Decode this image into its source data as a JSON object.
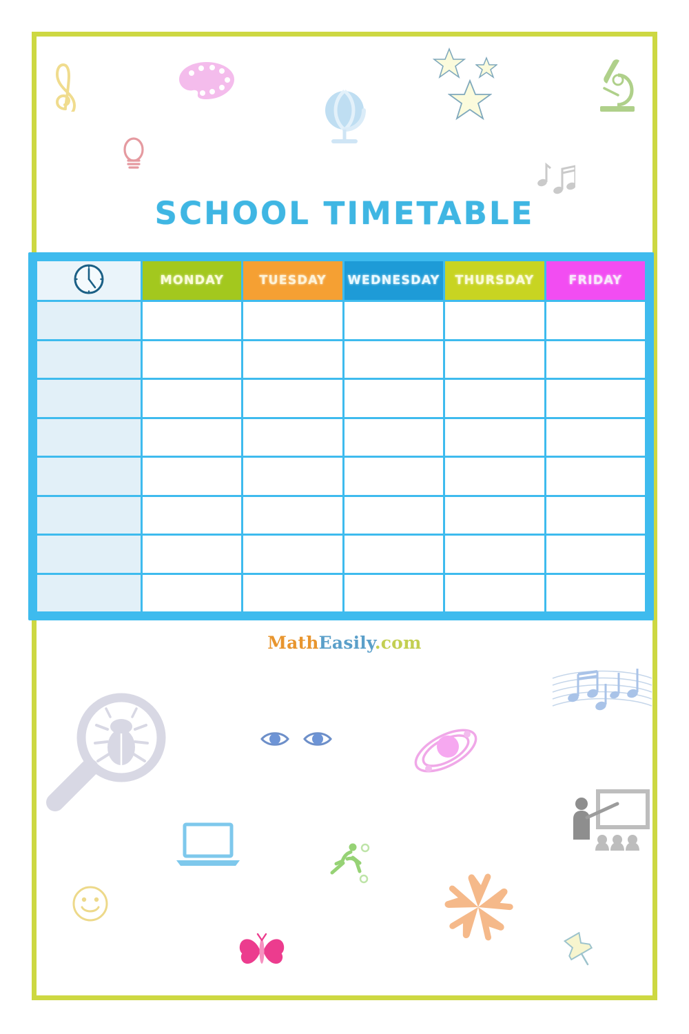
{
  "page": {
    "title": "SCHOOL TIMETABLE",
    "border_color": "#CDD842",
    "background_color": "#FFFFFF",
    "title_color": "#3FB6E3"
  },
  "watermark": {
    "part1": "Math",
    "part2": "Easily",
    "part3": ".com",
    "part1_color": "#E8952E",
    "part2_color": "#5A9FC9",
    "part3_color": "#C3CF52"
  },
  "timetable": {
    "frame_color": "#3EBBEE",
    "time_column_color": "#E2F0F8",
    "slot_color": "#FFFFFF",
    "header_text_color": "#FBFBD8",
    "clock_icon": "clock-icon",
    "clock_cell_bg": "#EAF4FA",
    "columns": [
      {
        "label": "",
        "icon": "clock-icon",
        "bg": "#EAF4FA",
        "is_clock": true
      },
      {
        "label": "MONDAY",
        "bg": "#A3C81E",
        "text": "#FBFBD8"
      },
      {
        "label": "TUESDAY",
        "bg": "#F5A033",
        "text": "#FDF3D8"
      },
      {
        "label": "WEDNESDAY",
        "bg": "#1E9BD7",
        "text": "#EAF9FF"
      },
      {
        "label": "THURSDAY",
        "bg": "#C8D422",
        "text": "#FBFBD8"
      },
      {
        "label": "FRIDAY",
        "bg": "#F24DF2",
        "text": "#F8E8FB"
      }
    ],
    "row_count": 8,
    "rows": [
      {
        "time": "",
        "slots": [
          "",
          "",
          "",
          "",
          ""
        ]
      },
      {
        "time": "",
        "slots": [
          "",
          "",
          "",
          "",
          ""
        ]
      },
      {
        "time": "",
        "slots": [
          "",
          "",
          "",
          "",
          ""
        ]
      },
      {
        "time": "",
        "slots": [
          "",
          "",
          "",
          "",
          ""
        ]
      },
      {
        "time": "",
        "slots": [
          "",
          "",
          "",
          "",
          ""
        ]
      },
      {
        "time": "",
        "slots": [
          "",
          "",
          "",
          "",
          ""
        ]
      },
      {
        "time": "",
        "slots": [
          "",
          "",
          "",
          "",
          ""
        ]
      },
      {
        "time": "",
        "slots": [
          "",
          "",
          "",
          "",
          ""
        ]
      }
    ]
  },
  "decorations": {
    "top": [
      {
        "name": "treble-clef-icon",
        "color": "#F0DC8E"
      },
      {
        "name": "paint-palette-icon",
        "color": "#F4BCEC"
      },
      {
        "name": "lightbulb-icon",
        "color": "#E59AA0"
      },
      {
        "name": "globe-icon",
        "color": "#BFDEF2"
      },
      {
        "name": "star-icon",
        "color": "#FAFAD2"
      },
      {
        "name": "star-small-icon",
        "color": "#FAFAD2"
      },
      {
        "name": "star-large-icon",
        "color": "#FAFAD2"
      },
      {
        "name": "microscope-icon",
        "color": "#AFD08A"
      },
      {
        "name": "music-notes-icon",
        "color": "#C8C8C8"
      }
    ],
    "bottom": [
      {
        "name": "magnifier-bug-icon",
        "color": "#D8D8E4"
      },
      {
        "name": "eyes-icon",
        "color": "#6D94D6"
      },
      {
        "name": "atom-icon",
        "color": "#F0A8E8"
      },
      {
        "name": "music-staff-icon",
        "color": "#A9C3E8"
      },
      {
        "name": "teacher-board-icon",
        "color": "#B8B8B8"
      },
      {
        "name": "laptop-icon",
        "color": "#7EC8EC"
      },
      {
        "name": "soccer-player-icon",
        "color": "#96D275"
      },
      {
        "name": "smiley-icon",
        "color": "#EDD98A"
      },
      {
        "name": "butterfly-icon",
        "color": "#EC3C8E"
      },
      {
        "name": "teamwork-hands-icon",
        "color": "#F5B98A"
      },
      {
        "name": "pushpin-icon",
        "color": "#F4F3C0"
      }
    ]
  }
}
